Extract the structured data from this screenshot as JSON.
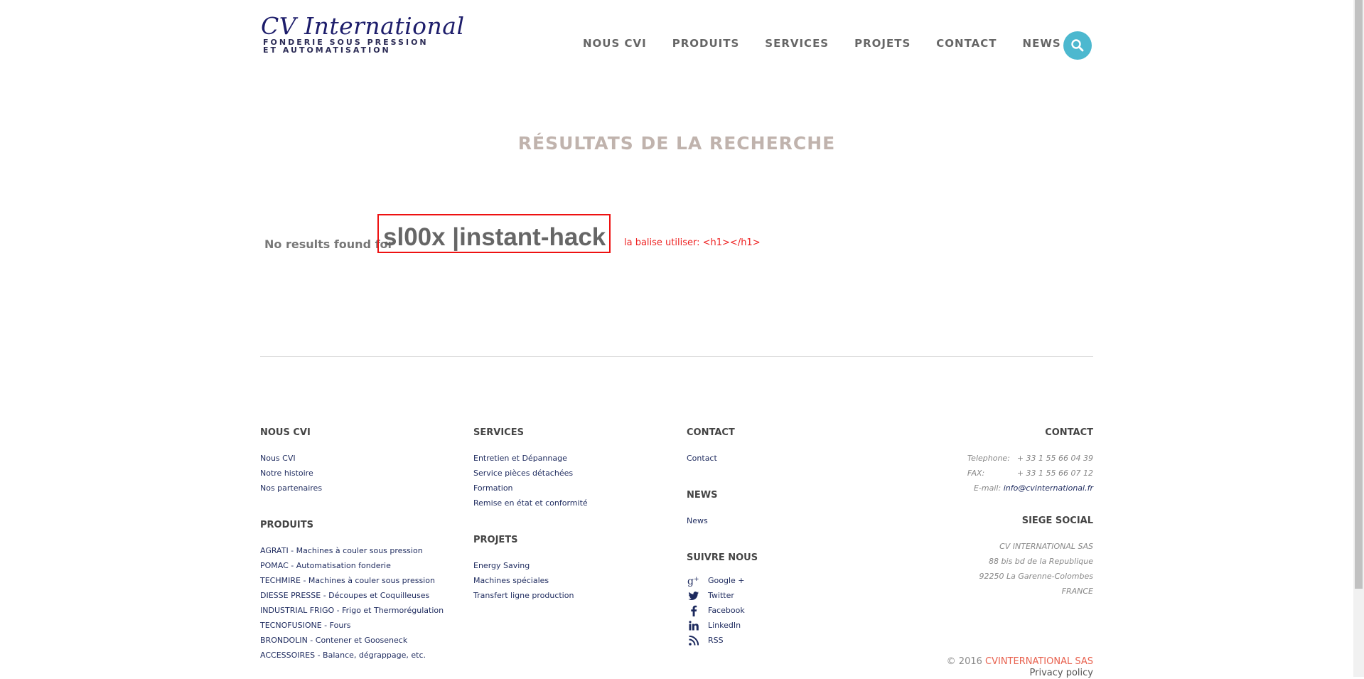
{
  "header": {
    "logo_title": "CV International",
    "logo_line1": "FONDERIE SOUS PRESSION",
    "logo_line2": "ET AUTOMATISATION",
    "nav": [
      "NOUS CVI",
      "PRODUITS",
      "SERVICES",
      "PROJETS",
      "CONTACT",
      "NEWS"
    ],
    "search_icon": "search-icon",
    "accent_color": "#4cb8cf"
  },
  "main": {
    "title": "RÉSULTATS DE LA RECHERCHE",
    "no_results_label": "No results found for",
    "query": "sl00x |instant-hack",
    "annotation": "la balise utiliser: <h1></h1>"
  },
  "footer": {
    "nous_cvi": {
      "heading": "NOUS CVI",
      "links": [
        "Nous CVI",
        "Notre histoire",
        "Nos partenaires"
      ]
    },
    "produits": {
      "heading": "PRODUITS",
      "links": [
        {
          "brand": "AGRATI",
          "desc": " - Machines à couler sous pression"
        },
        {
          "brand": "POMAC",
          "desc": " - Automatisation fonderie"
        },
        {
          "brand": "TECHMIRE",
          "desc": " - Machines à couler sous pression"
        },
        {
          "brand": "DIESSE PRESSE",
          "desc": " - Découpes et Coquilleuses"
        },
        {
          "brand": "INDUSTRIAL FRIGO",
          "desc": " - Frigo et Thermorégulation"
        },
        {
          "brand": "TECNOFUSIONE",
          "desc": " - Fours"
        },
        {
          "brand": "BRONDOLIN",
          "desc": " - Contener et Gooseneck"
        },
        {
          "brand": "ACCESSOIRES",
          "desc": " - Balance, dégrappage, etc."
        }
      ]
    },
    "services": {
      "heading": "SERVICES",
      "links": [
        "Entretien et Dépannage",
        "Service pièces détachées",
        "Formation",
        "Remise en état et conformité"
      ]
    },
    "projets": {
      "heading": "PROJETS",
      "links": [
        "Energy Saving",
        "Machines spéciales",
        "Transfert ligne production"
      ]
    },
    "contact": {
      "heading": "CONTACT",
      "links": [
        "Contact"
      ]
    },
    "news": {
      "heading": "NEWS",
      "links": [
        "News"
      ]
    },
    "suivre": {
      "heading": "SUIVRE NOUS",
      "items": [
        {
          "label": "Google +",
          "icon": "google-plus-icon"
        },
        {
          "label": "Twitter",
          "icon": "twitter-icon"
        },
        {
          "label": "Facebook",
          "icon": "facebook-icon"
        },
        {
          "label": "LinkedIn",
          "icon": "linkedin-icon"
        },
        {
          "label": "RSS",
          "icon": "rss-icon"
        }
      ]
    },
    "contact_info": {
      "heading": "CONTACT",
      "tel_label": "Telephone:",
      "tel": "+ 33 1 55 66 04 39",
      "fax_label": "FAX:",
      "fax": "+ 33 1 55 66 07 12",
      "email_label": "E-mail: ",
      "email": "info@cvinternational.fr"
    },
    "siege": {
      "heading": "SIEGE SOCIAL",
      "lines": [
        "CV INTERNATIONAL SAS",
        "88 bis bd de la Republique",
        "92250 La Garenne-Colombes",
        "FRANCE"
      ]
    },
    "copyright": "© 2016 ",
    "copyright_brand": "CVINTERNATIONAL SAS",
    "privacy": "Privacy policy"
  }
}
